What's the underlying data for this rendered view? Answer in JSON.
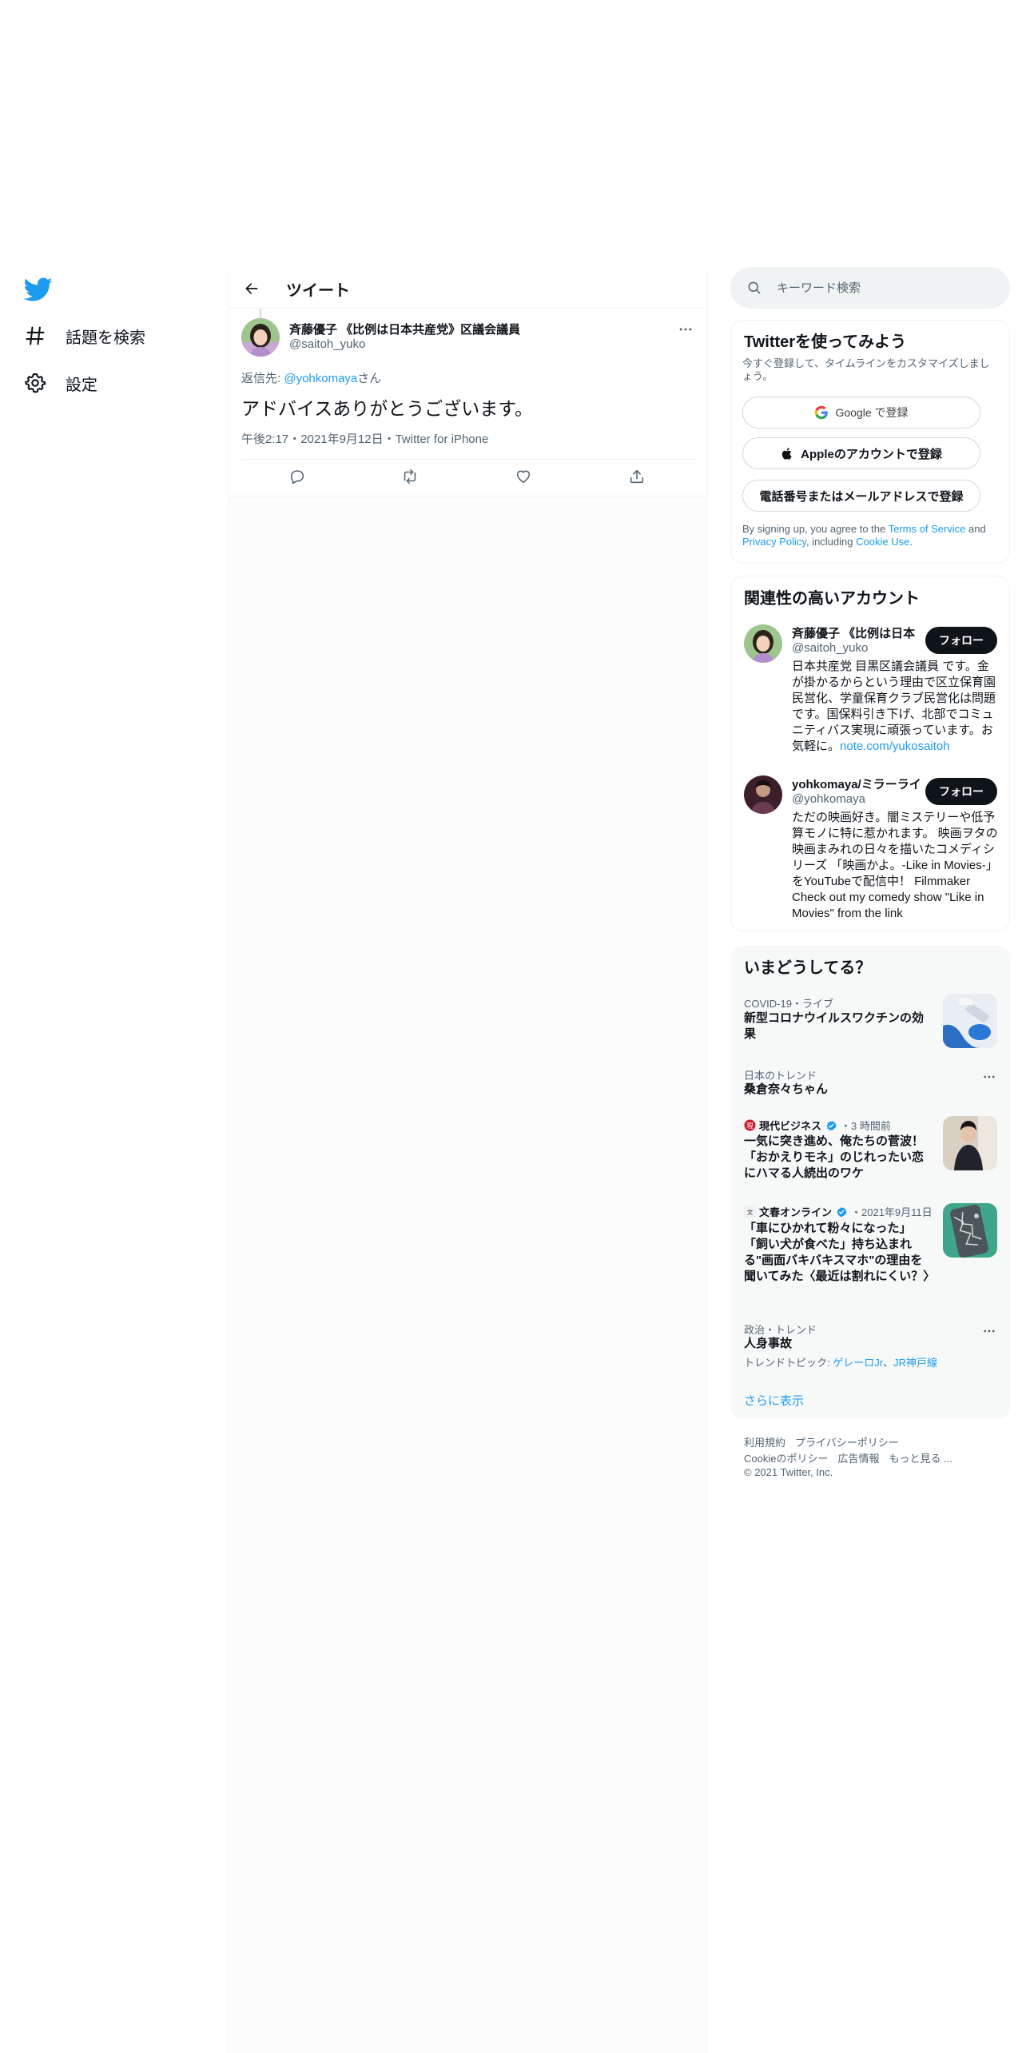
{
  "nav": {
    "items": [
      {
        "label": "話題を検索",
        "icon": "hashtag-icon"
      },
      {
        "label": "設定",
        "icon": "gear-icon"
      }
    ]
  },
  "header": {
    "title": "ツイート"
  },
  "tweet": {
    "author_name": "斉藤優子 《比例は日本共産党》区議会議員",
    "author_handle": "@saitoh_yuko",
    "reply_prefix": "返信先: ",
    "reply_to": "@yohkomaya",
    "reply_suffix": "さん",
    "text": "アドバイスありがとうございます。",
    "meta": "午後2:17・2021年9月12日・Twitter for iPhone"
  },
  "search": {
    "placeholder": "キーワード検索"
  },
  "signup": {
    "title": "Twitterを使ってみよう",
    "desc": "今すぐ登録して、タイムラインをカスタマイズしましょう。",
    "google_label": "Google で登録",
    "apple_label": "Appleのアカウントで登録",
    "phone_label": "電話番号またはメールアドレスで登録",
    "legal_1": "By signing up, you agree to the ",
    "terms": "Terms of Service",
    "legal_2": " and ",
    "privacy": "Privacy Policy",
    "legal_3": ", including ",
    "cookie": "Cookie Use",
    "legal_4": "."
  },
  "relevant": {
    "title": "関連性の高いアカウント",
    "accounts": [
      {
        "name": "斉藤優子 《比例は日本",
        "handle": "@saitoh_yuko",
        "follow": "フォロー",
        "bio": "日本共産党 目黒区議会議員 です。金が掛かるからという理由で区立保育園民営化、学童保育クラブ民営化は問題です。国保料引き下げ、北部でコミュニティバス実現に頑張っています。お気軽に。",
        "bio_link": "note.com/yukosaitoh"
      },
      {
        "name": "yohkomaya/ミラーライ",
        "handle": "@yohkomaya",
        "follow": "フォロー",
        "bio": "ただの映画好き。闇ミステリーや低予算モノに特に惹かれます。 映画ヲタの映画まみれの日々を描いたコメディシリーズ 「映画かよ。-Like in Movies-」をYouTubeで配信中！ Filmmaker Check out my comedy show \"Like in Movies\" from the link"
      }
    ]
  },
  "trends": {
    "title": "いまどうしてる？",
    "items": [
      {
        "meta": "COVID-19・ライブ",
        "title": "新型コロナウイルスワクチンの効果"
      },
      {
        "meta": "日本のトレンド",
        "title": "桑倉奈々ちゃん"
      },
      {
        "source": "現代ビジネス",
        "meta": "・3 時間前",
        "title": "一気に突き進め、俺たちの菅波！「おかえりモネ」のじれったい恋にハマる人続出のワケ"
      },
      {
        "source": "文春オンライン",
        "meta": "・2021年9月11日",
        "title": "「車にひかれて粉々になった」「飼い犬が食べた」持ち込まれる\"画面バキバキスマホ\"の理由を聞いてみた〈最近は割れにくい？〉"
      },
      {
        "meta": "政治・トレンド",
        "title": "人身事故"
      }
    ],
    "topics_prefix": "トレンドトピック: ",
    "topic_1": "ゲレーロJr",
    "topic_sep": "、",
    "topic_2": "JR神戸線",
    "show_more": "さらに表示"
  },
  "footer": {
    "terms": "利用規約",
    "privacy": "プライバシーポリシー",
    "cookie": "Cookieのポリシー",
    "ads": "広告情報",
    "more": "もっと見る ...",
    "copyright": "© 2021 Twitter, Inc."
  },
  "colors": {
    "accent": "#1d9bf0",
    "text": "#0f1419",
    "muted": "#536471"
  }
}
